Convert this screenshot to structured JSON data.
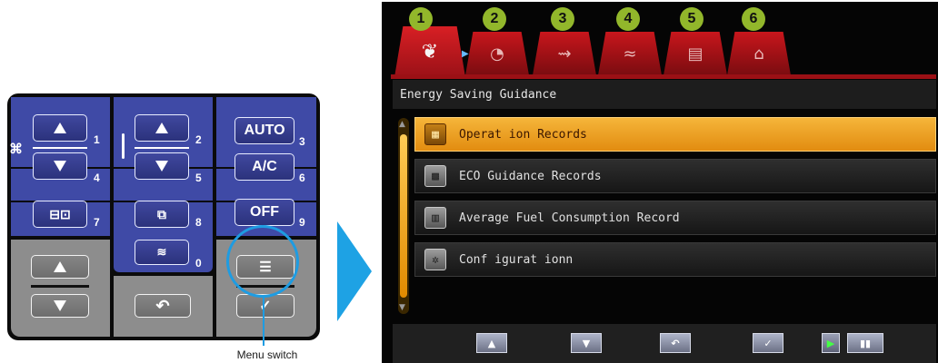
{
  "keypad": {
    "numbers": [
      "1",
      "2",
      "3",
      "4",
      "5",
      "6",
      "7",
      "8",
      "9",
      "0"
    ],
    "auto_label": "AUTO",
    "ac_label": "A/C",
    "off_label": "OFF",
    "fan_glyph": "⌘",
    "menu_glyph": "☰",
    "back_glyph": "↶",
    "check_glyph": "✓"
  },
  "callout": {
    "label": "Menu switch"
  },
  "screen": {
    "tabs": [
      {
        "num": "1",
        "icon": "leaf-icon",
        "glyph": "🍃"
      },
      {
        "num": "2",
        "icon": "gauge-icon",
        "glyph": "◔"
      },
      {
        "num": "3",
        "icon": "hose-icon",
        "glyph": "⇝"
      },
      {
        "num": "4",
        "icon": "wave-icon",
        "glyph": "≈"
      },
      {
        "num": "5",
        "icon": "list-icon",
        "glyph": "▤"
      },
      {
        "num": "6",
        "icon": "engine-icon",
        "glyph": "⌂"
      }
    ],
    "title": "Energy Saving Guidance",
    "items": [
      {
        "label": "Operat ion Records",
        "glyph": "▦"
      },
      {
        "label": "ECO Guidance Records",
        "glyph": "▩"
      },
      {
        "label": "Average Fuel Consumption Record",
        "glyph": "▥"
      },
      {
        "label": "Conf igurat ionn",
        "glyph": "✲"
      }
    ],
    "buttons": [
      "▲",
      "▼",
      "↶",
      "✓",
      "▶",
      "▮▮"
    ]
  },
  "colors": {
    "keypad_blue": "#3f4aa6",
    "keypad_gray": "#8d8d8d",
    "accent_blue": "#1e9ce2",
    "tab_red": "#c8161c",
    "selected_orange": "#f0a830",
    "tab_number_green": "#92b72b"
  }
}
